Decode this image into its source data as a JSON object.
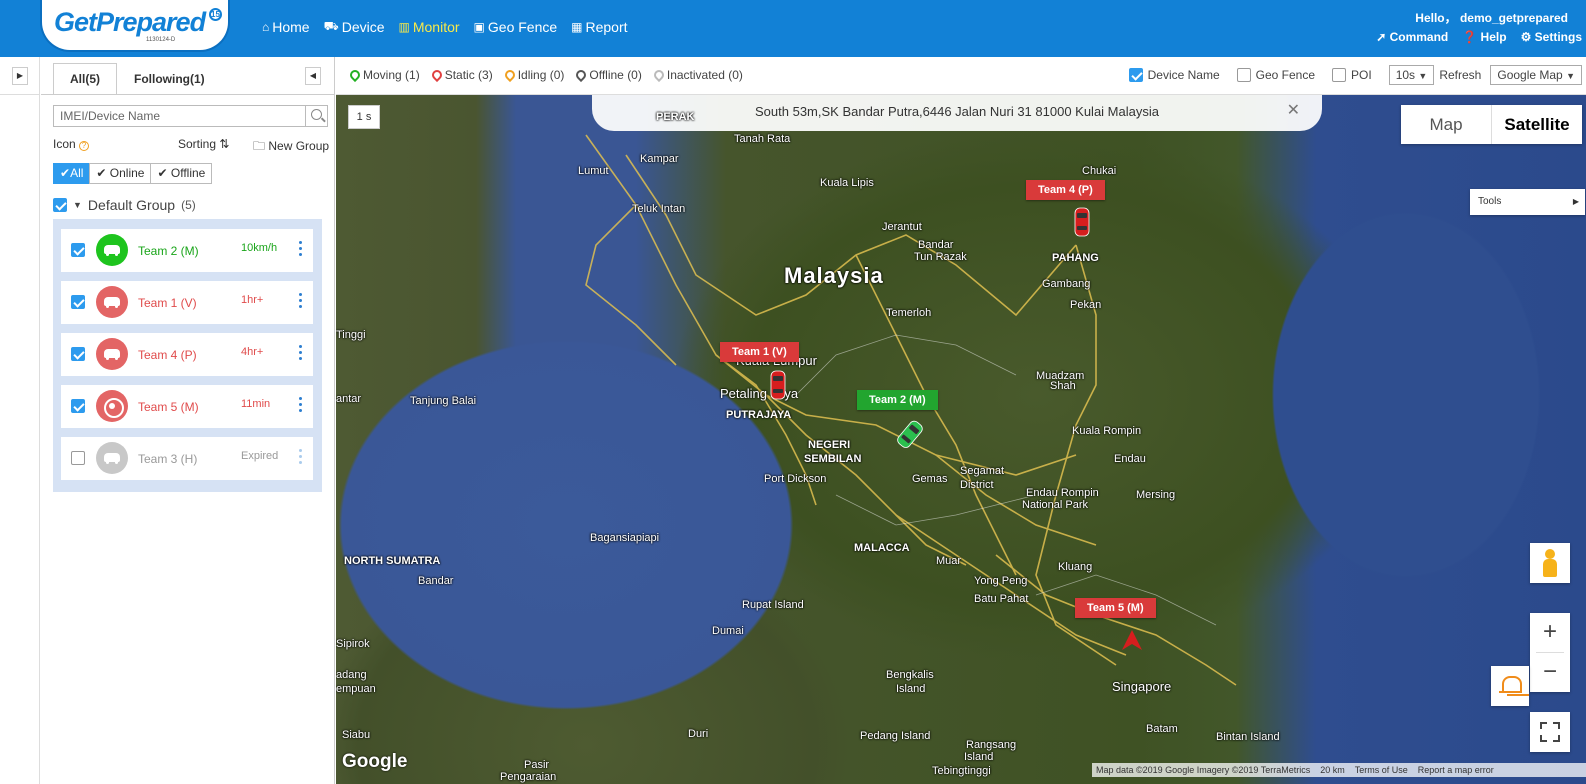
{
  "header": {
    "logo_text": "GetPrepared",
    "logo_badge": "15",
    "logo_sub": "1130124-D",
    "nav": [
      {
        "label": "Home",
        "icon": "home-icon",
        "active": false
      },
      {
        "label": "Device",
        "icon": "car-icon",
        "active": false
      },
      {
        "label": "Monitor",
        "icon": "map-icon",
        "active": true
      },
      {
        "label": "Geo Fence",
        "icon": "fence-icon",
        "active": false
      },
      {
        "label": "Report",
        "icon": "table-icon",
        "active": false
      }
    ],
    "greeting": "Hello，  demo_getprepared",
    "actions": [
      {
        "label": "Command",
        "icon": "send-icon"
      },
      {
        "label": "Help",
        "icon": "question-icon"
      },
      {
        "label": "Settings",
        "icon": "gear-icon"
      }
    ]
  },
  "panel": {
    "tabs": [
      "All(5)",
      "Following(1)"
    ],
    "search_placeholder": "IMEI/Device Name",
    "icon_label": "Icon",
    "sorting_label": "Sorting",
    "new_group_label": "New Group",
    "filters": [
      "All",
      "Online",
      "Offline"
    ],
    "group_name": "Default Group",
    "group_count": "(5)",
    "devices": [
      {
        "name": "Team 2   (M)",
        "status": "10km/h",
        "color": "#1ec41e",
        "text_color": "#1aa51a",
        "checked": true,
        "icon": "car-icon"
      },
      {
        "name": "Team 1   (V)",
        "status": "1hr+",
        "color": "#e36565",
        "text_color": "#e04b4b",
        "checked": true,
        "icon": "car-icon"
      },
      {
        "name": "Team 4   (P)",
        "status": "4hr+",
        "color": "#e36565",
        "text_color": "#e04b4b",
        "checked": true,
        "icon": "car-icon"
      },
      {
        "name": "Team 5   (M)",
        "status": "11min",
        "color": "#e36565",
        "text_color": "#e04b4b",
        "checked": true,
        "icon": "target-icon"
      },
      {
        "name": "Team 3   (H)",
        "status": "Expired",
        "color": "#c8c8c8",
        "text_color": "#999999",
        "checked": false,
        "icon": "car-icon"
      }
    ]
  },
  "statusbar": {
    "legend": [
      {
        "label": "Moving (1)",
        "color": "#22b022"
      },
      {
        "label": "Static (3)",
        "color": "#e04040"
      },
      {
        "label": "Idling (0)",
        "color": "#f0a020"
      },
      {
        "label": "Offline (0)",
        "color": "#555555"
      },
      {
        "label": "Inactivated (0)",
        "color": "#bbbbbb"
      }
    ],
    "device_name_label": "Device Name",
    "geo_fence_label": "Geo Fence",
    "poi_label": "POI",
    "refresh_interval": "10s",
    "refresh_label": "Refresh",
    "map_provider": "Google Map"
  },
  "map": {
    "address": "South 53m,SK Bandar Putra,6446 Jalan Nuri 31 81000 Kulai Malaysia",
    "speed_label": "1 s",
    "map_type": [
      "Map",
      "Satellite"
    ],
    "tools_label": "Tools",
    "google_logo": "Google",
    "attribution": [
      "Map data ©2019 Google Imagery ©2019 TerraMetrics",
      "20 km",
      "Terms of Use",
      "Report a map error"
    ],
    "labels": [
      {
        "text": "Malaysia",
        "size": "big"
      },
      {
        "text": "Kuala Lumpur",
        "size": "med"
      },
      {
        "text": "Petaling Jaya",
        "size": "med"
      },
      {
        "text": "PUTRAJAYA",
        "size": "bold"
      },
      {
        "text": "NEGERI",
        "size": "bold"
      },
      {
        "text": "SEMBILAN",
        "size": "bold"
      },
      {
        "text": "MALACCA",
        "size": "bold"
      },
      {
        "text": "PAHANG",
        "size": "bold"
      },
      {
        "text": "NORTH SUMATRA",
        "size": "bold"
      },
      {
        "text": "PERAK",
        "size": "bold"
      },
      {
        "text": "Singapore",
        "size": "med"
      },
      {
        "text": "Kampar",
        "size": ""
      },
      {
        "text": "Tanah Rata",
        "size": ""
      },
      {
        "text": "Kuala Lipis",
        "size": ""
      },
      {
        "text": "Lumut",
        "size": ""
      },
      {
        "text": "Teluk Intan",
        "size": ""
      },
      {
        "text": "Jerantut",
        "size": ""
      },
      {
        "text": "Bandar",
        "size": ""
      },
      {
        "text": "Tun Razak",
        "size": ""
      },
      {
        "text": "Chukai",
        "size": ""
      },
      {
        "text": "Gambang",
        "size": ""
      },
      {
        "text": "Pekan",
        "size": ""
      },
      {
        "text": "Temerloh",
        "size": ""
      },
      {
        "text": "Muadzam",
        "size": ""
      },
      {
        "text": "Shah",
        "size": ""
      },
      {
        "text": "Kuala Rompin",
        "size": ""
      },
      {
        "text": "Endau",
        "size": ""
      },
      {
        "text": "Segamat",
        "size": ""
      },
      {
        "text": "District",
        "size": ""
      },
      {
        "text": "Endau Rompin",
        "size": ""
      },
      {
        "text": "National Park",
        "size": ""
      },
      {
        "text": "Mersing",
        "size": ""
      },
      {
        "text": "Gemas",
        "size": ""
      },
      {
        "text": "Port Dickson",
        "size": ""
      },
      {
        "text": "Tinggi",
        "size": ""
      },
      {
        "text": "antar",
        "size": ""
      },
      {
        "text": "Tanjung Balai",
        "size": ""
      },
      {
        "text": "Bagansiapiapi",
        "size": ""
      },
      {
        "text": "Bandar",
        "size": ""
      },
      {
        "text": "Rupat Island",
        "size": ""
      },
      {
        "text": "Dumai",
        "size": ""
      },
      {
        "text": "Muar",
        "size": ""
      },
      {
        "text": "Yong Peng",
        "size": ""
      },
      {
        "text": "Batu Pahat",
        "size": ""
      },
      {
        "text": "Kluang",
        "size": ""
      },
      {
        "text": "Bengkalis",
        "size": ""
      },
      {
        "text": "Island",
        "size": ""
      },
      {
        "text": "Pedang Island",
        "size": ""
      },
      {
        "text": "Rangsang",
        "size": ""
      },
      {
        "text": "Island",
        "size": ""
      },
      {
        "text": "Batam",
        "size": ""
      },
      {
        "text": "Bintan Island",
        "size": ""
      },
      {
        "text": "Duri",
        "size": ""
      },
      {
        "text": "Sipirok",
        "size": ""
      },
      {
        "text": "adang",
        "size": ""
      },
      {
        "text": "empuan",
        "size": ""
      },
      {
        "text": "Pasir",
        "size": ""
      },
      {
        "text": "Pengaraian",
        "size": ""
      },
      {
        "text": "Tebingtinggi",
        "size": ""
      },
      {
        "text": "Siabu",
        "size": ""
      }
    ],
    "vehicles": [
      {
        "tag": "Team 4   (P)",
        "color": "red"
      },
      {
        "tag": "Team 1   (V)",
        "color": "red"
      },
      {
        "tag": "Team 2   (M)",
        "color": "green"
      },
      {
        "tag": "Team 5   (M)",
        "color": "red"
      }
    ]
  }
}
